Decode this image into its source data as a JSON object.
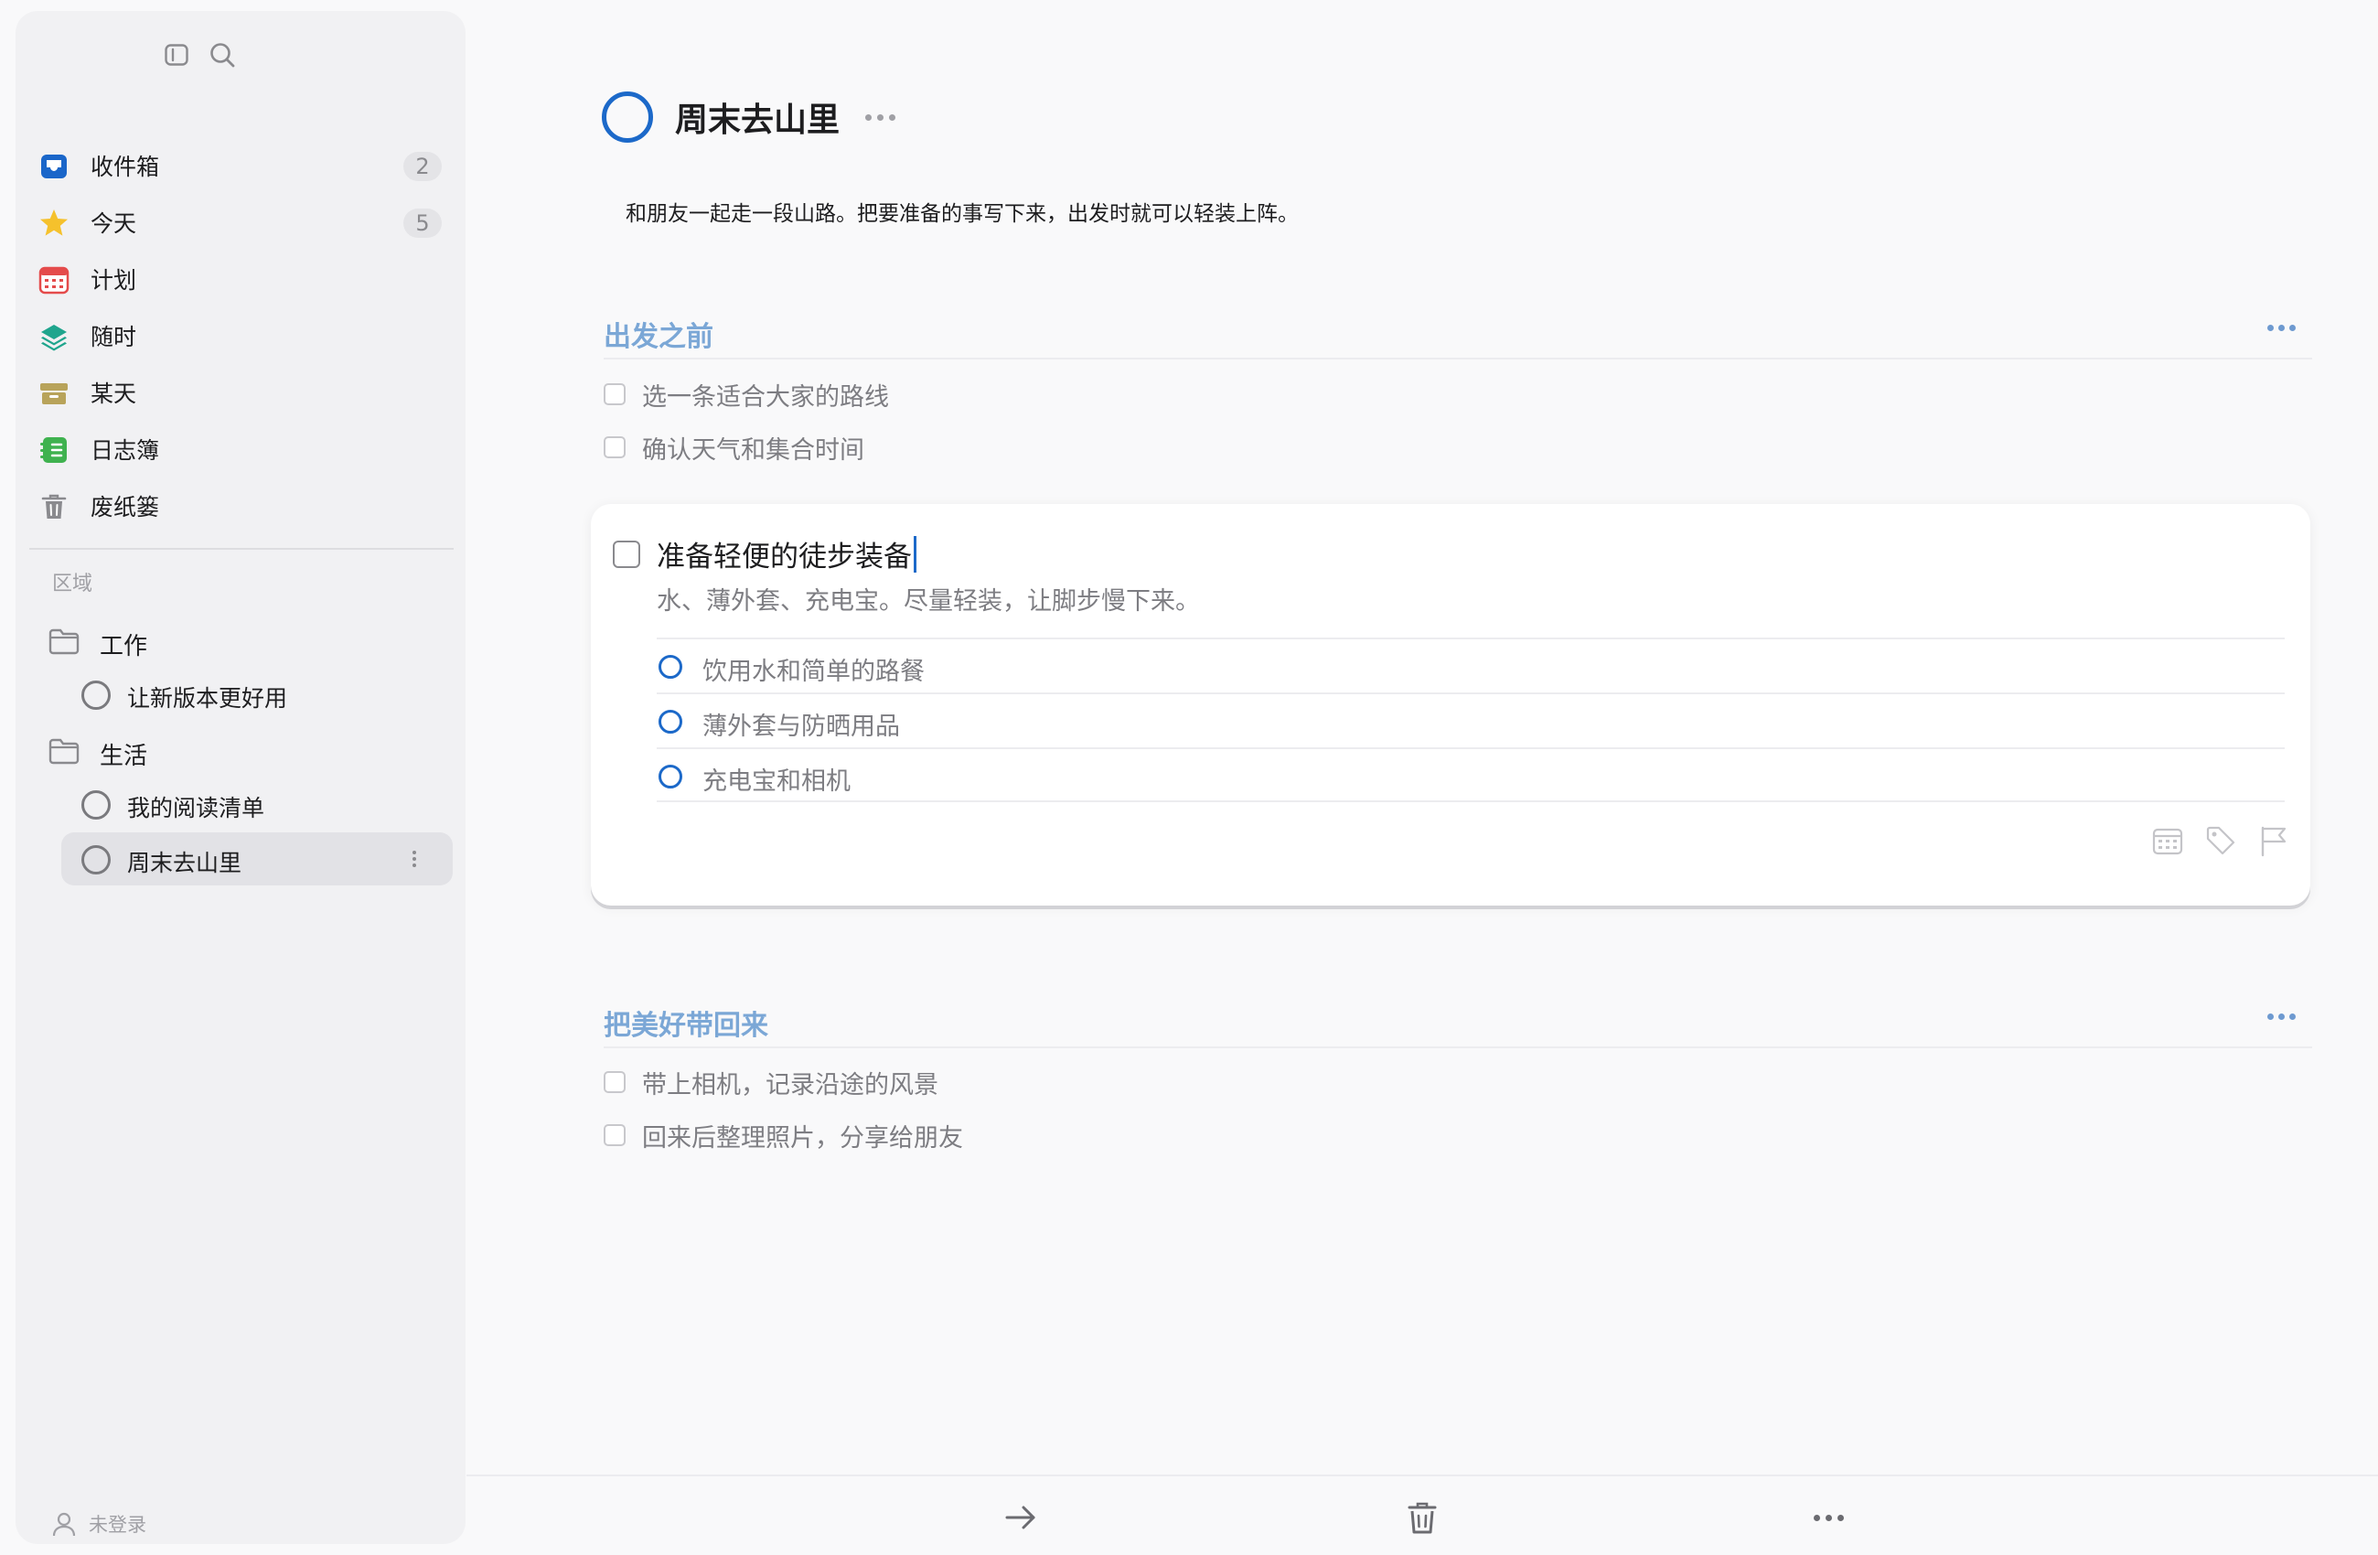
{
  "sidebar": {
    "toolbar": {
      "toggle_icon": "sidebar-toggle-icon",
      "search_icon": "search-icon"
    },
    "nav": [
      {
        "label": "收件箱",
        "icon": "inbox-icon",
        "count": "2",
        "color": "#1a66c9"
      },
      {
        "label": "今天",
        "icon": "star-icon",
        "count": "5",
        "color": "#f5c12c"
      },
      {
        "label": "计划",
        "icon": "calendar-icon",
        "count": "",
        "color": "#e44b4b"
      },
      {
        "label": "随时",
        "icon": "layers-icon",
        "count": "",
        "color": "#1fa58d"
      },
      {
        "label": "某天",
        "icon": "archive-box-icon",
        "count": "",
        "color": "#b8a35a"
      },
      {
        "label": "日志簿",
        "icon": "logbook-icon",
        "count": "",
        "color": "#3fb24f"
      },
      {
        "label": "废纸篓",
        "icon": "trash-icon",
        "count": "",
        "color": "#8a8a8e"
      }
    ],
    "areas_label": "区域",
    "areas": [
      {
        "label": "工作",
        "projects": [
          {
            "label": "让新版本更好用"
          }
        ]
      },
      {
        "label": "生活",
        "projects": [
          {
            "label": "我的阅读清单"
          },
          {
            "label": "周末去山里",
            "selected": true
          }
        ]
      }
    ],
    "user_label": "未登录"
  },
  "project": {
    "title": "周末去山里",
    "notes": "和朋友一起走一段山路。把要准备的事写下来，出发时就可以轻装上阵。",
    "accent": "#1c69c9"
  },
  "headings": [
    {
      "title": "出发之前",
      "todos": [
        "选一条适合大家的路线",
        "确认天气和集合时间"
      ]
    },
    {
      "title": "把美好带回来",
      "todos": [
        "带上相机，记录沿途的风景",
        "回来后整理照片，分享给朋友"
      ]
    }
  ],
  "open_todo": {
    "title": "准备轻便的徒步装备",
    "notes": "水、薄外套、充电宝。尽量轻装，让脚步慢下来。",
    "checklist": [
      "饮用水和简单的路餐",
      "薄外套与防晒用品",
      "充电宝和相机"
    ],
    "tools": [
      "calendar-icon",
      "tag-icon",
      "flag-icon"
    ]
  },
  "bottombar": [
    "move-arrow-icon",
    "trash-icon",
    "more-icon"
  ]
}
